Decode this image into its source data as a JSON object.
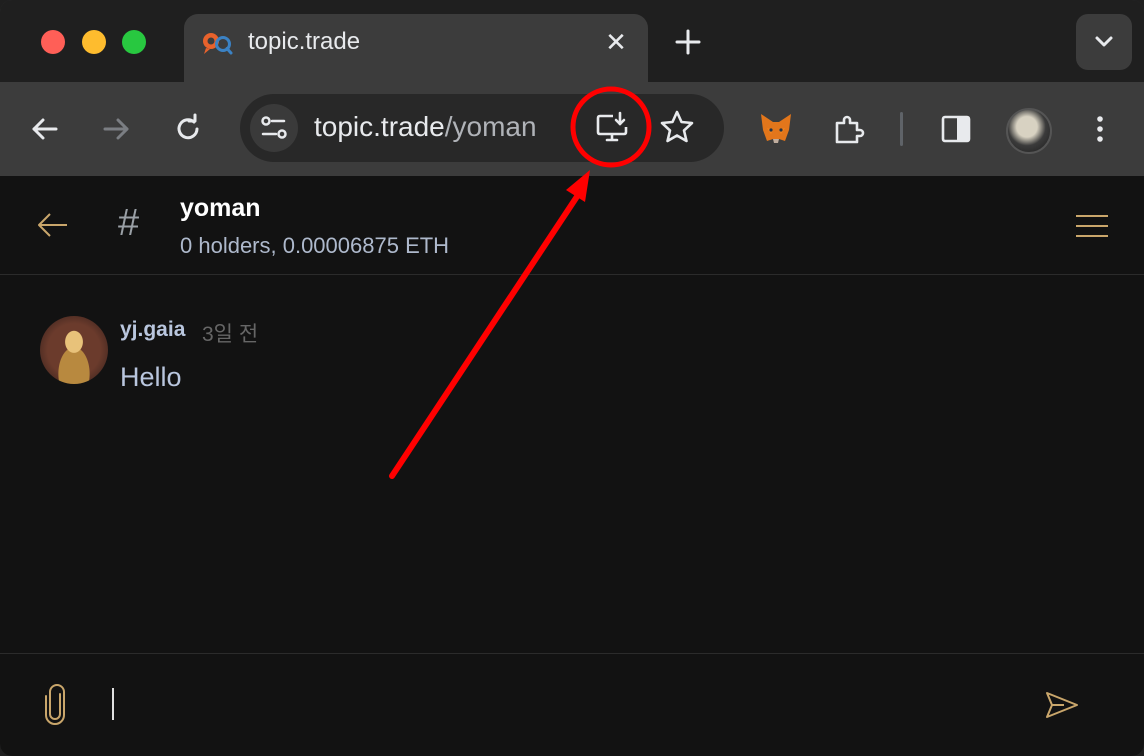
{
  "browser": {
    "tab": {
      "title": "topic.trade",
      "close_glyph": "✕"
    },
    "new_tab_glyph": "+",
    "omnibox": {
      "url_host": "topic.trade",
      "url_path": "/yoman"
    }
  },
  "channel": {
    "hash_glyph": "#",
    "name": "yoman",
    "subtitle": "0 holders, 0.00006875 ETH"
  },
  "messages": [
    {
      "author": "yj.gaia",
      "time": "3일 전",
      "text": "Hello"
    }
  ],
  "composer": {
    "value": ""
  },
  "colors": {
    "accent_gold": "#c9a66b",
    "annotation_red": "#ff0000",
    "text_primary": "#b9c6de"
  },
  "icons": {
    "toolbar": [
      "back-icon",
      "forward-icon",
      "reload-icon",
      "site-info-icon",
      "install-app-icon",
      "bookmark-star-icon",
      "metamask-icon",
      "extensions-icon",
      "side-panel-icon",
      "profile-avatar",
      "more-menu-icon"
    ],
    "page": [
      "back-arrow-icon",
      "hamburger-menu-icon",
      "paperclip-icon",
      "send-icon"
    ]
  }
}
